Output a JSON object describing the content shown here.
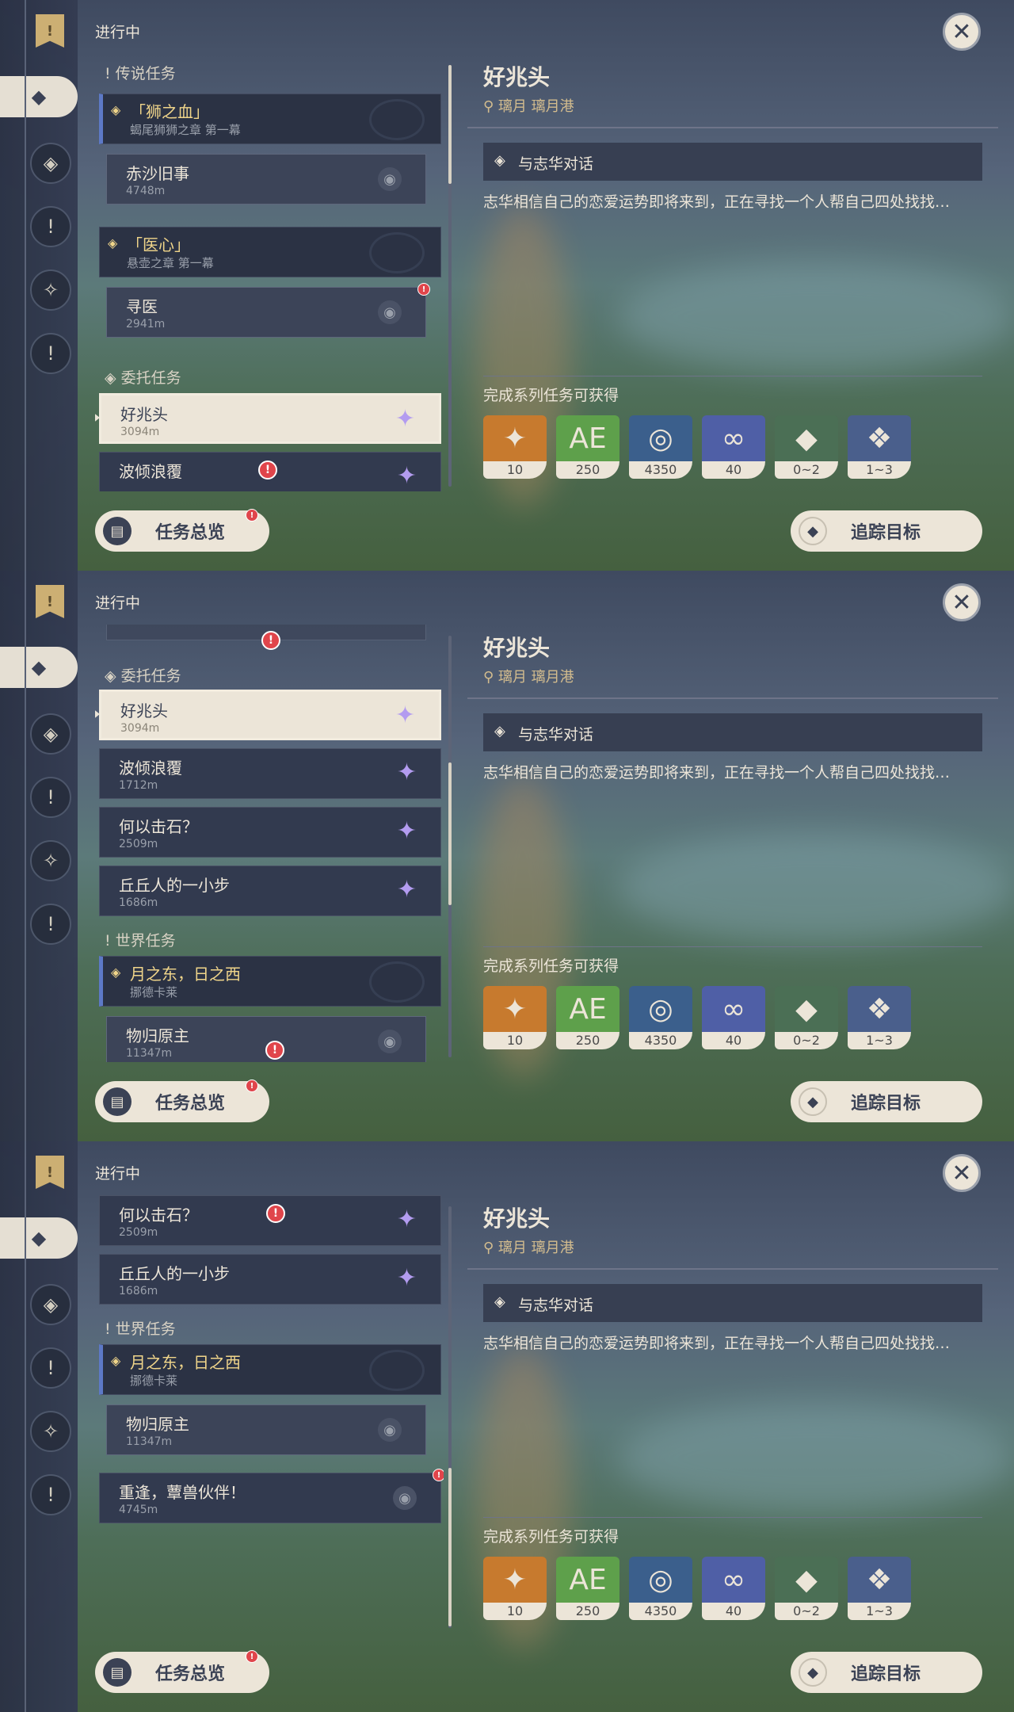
{
  "screens": [
    0,
    1,
    2
  ],
  "header": {
    "status_label": "进行中"
  },
  "sections": {
    "legend": "传说任务",
    "commission": "委托任务",
    "world": "世界任务"
  },
  "legend_quests": [
    {
      "title": "「狮之血」",
      "chapter": "蝎尾狮狮之章 第一幕"
    },
    {
      "title": "「医心」",
      "chapter": "悬壶之章 第一幕"
    }
  ],
  "legend_sub": [
    {
      "name": "赤沙旧事",
      "dist": "4748m"
    },
    {
      "name": "寻医",
      "dist": "2941m"
    }
  ],
  "commissions": [
    {
      "name": "好兆头",
      "dist": "3094m"
    },
    {
      "name": "波倾浪覆",
      "dist": "1712m"
    },
    {
      "name": "何以击石？",
      "dist": "2509m"
    },
    {
      "name": "丘丘人的一小步",
      "dist": "1686m"
    }
  ],
  "world_quest": {
    "title": "月之东，日之西",
    "sub": "挪德卡莱"
  },
  "world_sub": [
    {
      "name": "物归原主",
      "dist": "11347m"
    }
  ],
  "other_quest": {
    "name": "重逢，蕈兽伙伴！",
    "dist": "4745m"
  },
  "detail": {
    "title": "好兆头",
    "location": "璃月 璃月港",
    "objective": "与志华对话",
    "description": "志华相信自己的恋爱运势即将来到，正在寻找一个人帮自己四处找找…",
    "rewards_title": "完成系列任务可获得",
    "rewards": [
      {
        "icon": "primogem-icon",
        "count": "10",
        "bg": "#c77a2e"
      },
      {
        "icon": "adventure-exp-icon",
        "count": "250",
        "bg": "#5ea04b"
      },
      {
        "icon": "mora-icon",
        "count": "4350",
        "bg": "#3b5f8c"
      },
      {
        "icon": "companionship-exp-icon",
        "count": "40",
        "bg": "#4f5fa6"
      },
      {
        "icon": "crystal-chunk-icon",
        "count": "0~2",
        "bg": "#4b6f55"
      },
      {
        "icon": "crystal-cluster-icon",
        "count": "1~3",
        "bg": "#4a5f8c"
      }
    ]
  },
  "buttons": {
    "overview": "任务总览",
    "track": "追踪目标"
  }
}
